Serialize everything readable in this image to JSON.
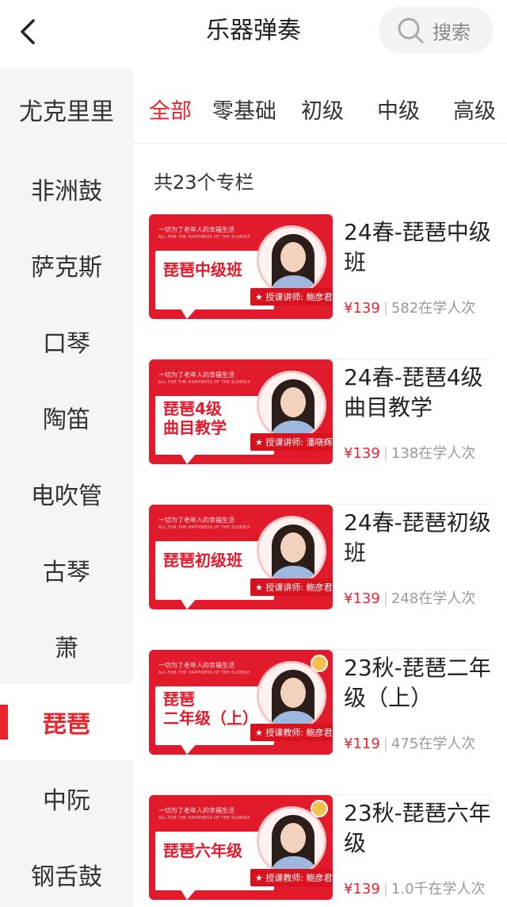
{
  "header": {
    "title": "乐器弹奏",
    "search_label": "搜索"
  },
  "sidebar": {
    "items": [
      {
        "label": "尤克里里",
        "active": false
      },
      {
        "label": "非洲鼓",
        "active": false
      },
      {
        "label": "萨克斯",
        "active": false
      },
      {
        "label": "口琴",
        "active": false
      },
      {
        "label": "陶笛",
        "active": false
      },
      {
        "label": "电吹管",
        "active": false
      },
      {
        "label": "古琴",
        "active": false
      },
      {
        "label": "萧",
        "active": false
      },
      {
        "label": "琵琶",
        "active": true
      },
      {
        "label": "中阮",
        "active": false
      },
      {
        "label": "钢舌鼓",
        "active": false
      }
    ]
  },
  "tabs": [
    {
      "label": "全部",
      "active": true
    },
    {
      "label": "零基础",
      "active": false
    },
    {
      "label": "初级",
      "active": false
    },
    {
      "label": "中级",
      "active": false
    },
    {
      "label": "高级",
      "active": false
    }
  ],
  "list": {
    "count_label": "共23个专栏",
    "thumb_slogan": "一切为了老年人的幸福生活",
    "thumb_slogan_en": "ALL FOR THE HAPPINESS OF THE ELDERLY",
    "courses": [
      {
        "title": "24春-琵琶中级班",
        "price": "¥139",
        "learners": "582在学人次",
        "thumb_text": "琵琶中级班",
        "teacher": "★ 授课讲师: 鲍彦君"
      },
      {
        "title": "24春-琵琶4级曲目教学",
        "price": "¥139",
        "learners": "138在学人次",
        "thumb_text": "琵琶4级\n曲目教学",
        "teacher": "★ 授课讲师: 潘晓辉"
      },
      {
        "title": "24春-琵琶初级班",
        "price": "¥139",
        "learners": "248在学人次",
        "thumb_text": "琵琶初级班",
        "teacher": "★ 授课讲师: 鲍彦君"
      },
      {
        "title": "23秋-琵琶二年级（上）",
        "price": "¥119",
        "learners": "475在学人次",
        "thumb_text": "琵琶\n二年级（上）",
        "teacher": "★ 授课教师: 鲍彦君"
      },
      {
        "title": "23秋-琵琶六年级",
        "price": "¥139",
        "learners": "1.0千在学人次",
        "thumb_text": "琵琶六年级",
        "teacher": "★ 授课教师: 鲍彦君"
      }
    ]
  },
  "colors": {
    "accent": "#e8242e",
    "thumb_red": "#e11a2c",
    "sidebar_bg": "#f5f5f5"
  },
  "icons": {
    "back": "chevron-left-icon",
    "search": "search-icon"
  }
}
